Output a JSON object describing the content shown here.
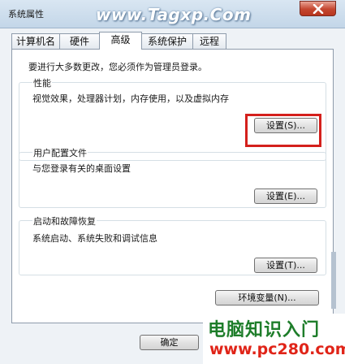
{
  "window": {
    "title": "系统属性",
    "watermark_top": "www.Tagxp.Com"
  },
  "tabs": [
    {
      "label": "计算机名",
      "active": false
    },
    {
      "label": "硬件",
      "active": false
    },
    {
      "label": "高级",
      "active": true
    },
    {
      "label": "系统保护",
      "active": false
    },
    {
      "label": "远程",
      "active": false
    }
  ],
  "panel": {
    "admin_note": "要进行大多数更改，您必须作为管理员登录。",
    "performance": {
      "title": "性能",
      "description": "视觉效果，处理器计划，内存使用，以及虚拟内存",
      "button_label": "设置(S)..."
    },
    "user_profiles": {
      "title": "用户配置文件",
      "description": "与您登录有关的桌面设置",
      "button_label": "设置(E)..."
    },
    "startup_recovery": {
      "title": "启动和故障恢复",
      "description": "系统启动、系统失败和调试信息",
      "button_label": "设置(T)..."
    },
    "env_button_label": "环境变量(N)..."
  },
  "footer": {
    "ok_label": "确定"
  },
  "watermark_bottom": {
    "line1": "电脑知识入门",
    "line2": "www.pc280.com"
  },
  "colors": {
    "highlight": "#d4201c",
    "watermark_green": "#1e7d2a",
    "watermark_red": "#e02418"
  }
}
